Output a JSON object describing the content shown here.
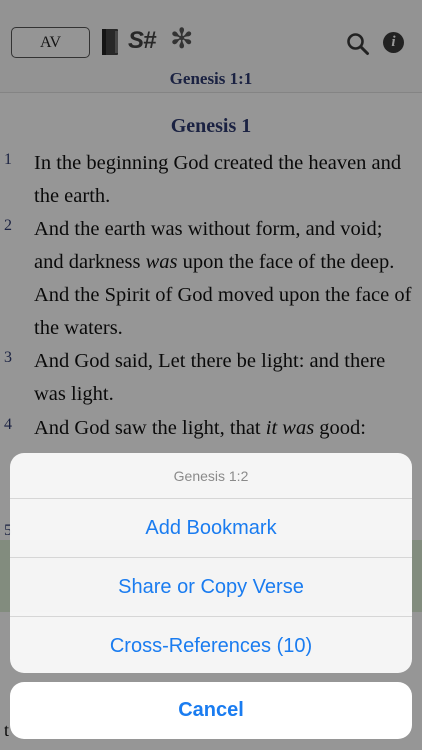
{
  "toolbar": {
    "version_label": "AV",
    "strongs_label": "S#",
    "asterisk_label": "✻"
  },
  "reference_bar": {
    "label": "Genesis 1:1"
  },
  "chapter": {
    "heading": "Genesis 1"
  },
  "verses": [
    {
      "number": "1",
      "text": "In the beginning God created the heaven and the earth."
    },
    {
      "number": "2",
      "text": "And the earth was without form, and void; and darkness <i>was</i> upon the face of the deep. And the Spirit of God moved upon the face of the waters."
    },
    {
      "number": "3",
      "text": "And God said, Let there be light: and there was light."
    },
    {
      "number": "4",
      "text": "And God saw the light, that <i>it was</i> good:"
    }
  ],
  "partial": {
    "verse5_number": "5",
    "lower_text": "t"
  },
  "action_sheet": {
    "title": "Genesis 1:2",
    "options": [
      {
        "label": "Add Bookmark"
      },
      {
        "label": "Share or Copy Verse"
      },
      {
        "label": "Cross-References (10)"
      }
    ],
    "cancel_label": "Cancel"
  },
  "colors": {
    "accent": "#1a7cf0",
    "heading": "#2d3a6e",
    "highlight": "#d9ead3"
  }
}
